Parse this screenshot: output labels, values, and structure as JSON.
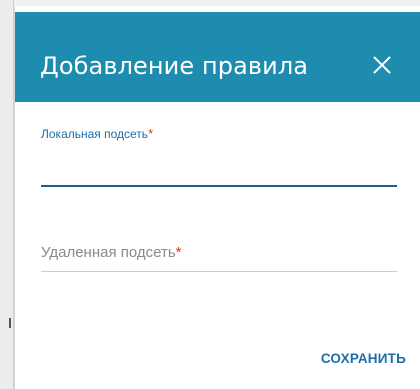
{
  "dialog": {
    "title": "Добавление правила",
    "header_color": "#1d8cae",
    "close_icon": "close-icon",
    "fields": [
      {
        "label": "Локальная подсеть",
        "required_mark": "*",
        "value": "",
        "state": "focused"
      },
      {
        "label": "Удаленная подсеть",
        "required_mark": "*",
        "value": "",
        "state": "idle"
      }
    ],
    "save_label": "СОХРАНИТЬ"
  }
}
